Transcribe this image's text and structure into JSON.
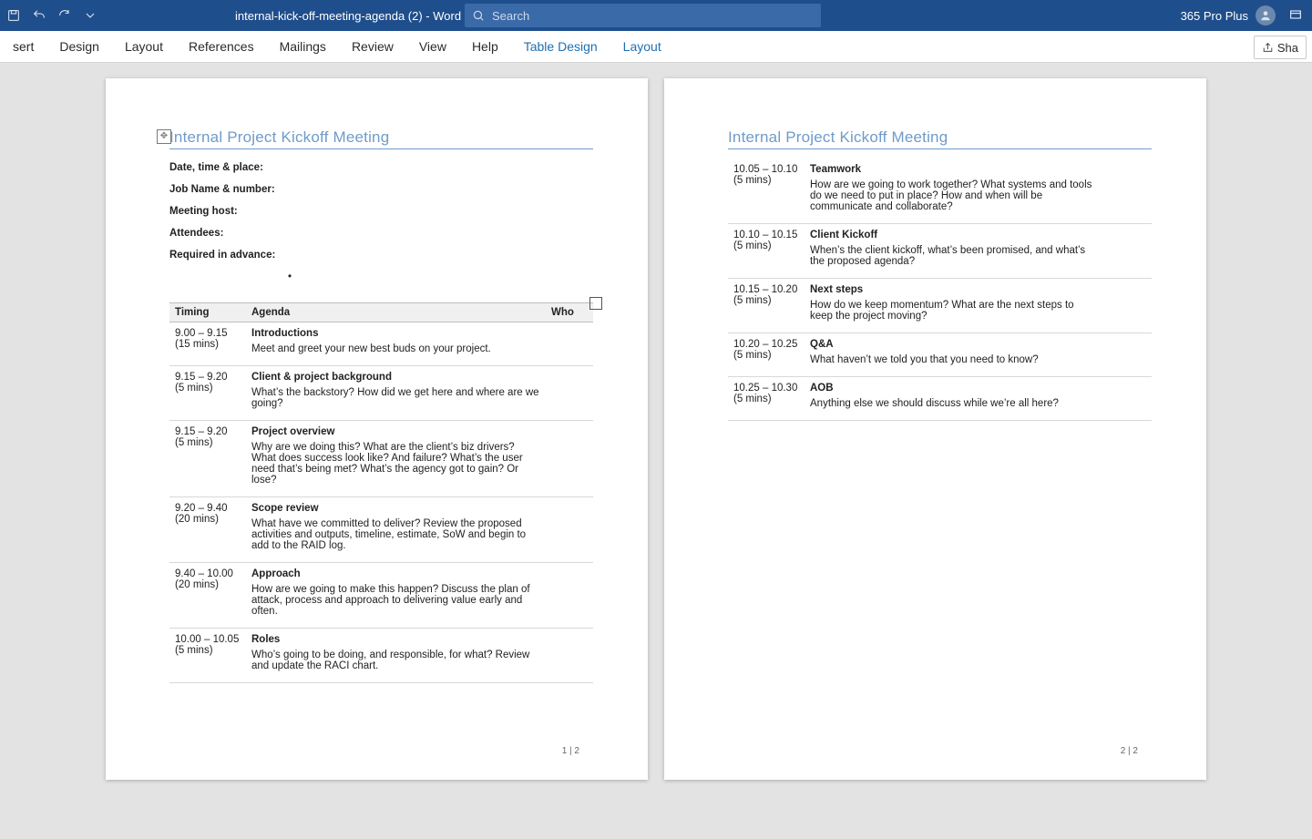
{
  "titlebar": {
    "doc_title": "internal-kick-off-meeting-agenda (2)  -  Word",
    "search_placeholder": "Search",
    "user_label": "365 Pro Plus"
  },
  "ribbon": {
    "tabs": [
      "sert",
      "Design",
      "Layout",
      "References",
      "Mailings",
      "Review",
      "View",
      "Help",
      "Table Design",
      "Layout"
    ],
    "share_label": "Sha"
  },
  "doc": {
    "title": "Internal Project Kickoff Meeting",
    "fields": {
      "date": "Date, time & place:",
      "job": "Job Name & number:",
      "host": "Meeting host:",
      "attendees": "Attendees:",
      "required": "Required in advance:"
    },
    "cols": {
      "timing": "Timing",
      "agenda": "Agenda",
      "who": "Who"
    },
    "page1_footer": "1 | 2",
    "page2_footer": "2 | 2"
  },
  "rows_p1": [
    {
      "time": "9.00 – 9.15",
      "dur": "(15 mins)",
      "title": "Introductions",
      "desc": "Meet and greet your new best buds on your project."
    },
    {
      "time": "9.15 – 9.20",
      "dur": "(5 mins)",
      "title": "Client & project background",
      "desc": "What’s the backstory? How did we get here and where are we going?"
    },
    {
      "time": "9.15 – 9.20",
      "dur": "(5 mins)",
      "title": "Project overview",
      "desc": "Why are we doing this? What are the client’s biz drivers? What does success look like? And failure? What’s the user need that’s being met? What’s the agency got to gain? Or lose?"
    },
    {
      "time": "9.20 – 9.40",
      "dur": "(20 mins)",
      "title": "Scope review",
      "desc": "What have we committed to deliver? Review the proposed activities and outputs, timeline, estimate, SoW and begin to add to the RAID log."
    },
    {
      "time": "9.40 – 10.00",
      "dur": "(20 mins)",
      "title": "Approach",
      "desc": "How are we going to make this happen? Discuss the plan of attack, process and approach to delivering value early and often."
    },
    {
      "time": "10.00 – 10.05",
      "dur": "(5 mins)",
      "title": "Roles",
      "desc": "Who’s going to be doing, and responsible, for what? Review and update the RACI chart."
    }
  ],
  "rows_p2": [
    {
      "time": "10.05 – 10.10",
      "dur": "(5 mins)",
      "title": "Teamwork",
      "desc": "How are we going to work together? What systems and tools do we need to put in place? How and when will be communicate and collaborate?"
    },
    {
      "time": "10.10 – 10.15",
      "dur": "(5 mins)",
      "title": "Client Kickoff",
      "desc": "When’s the client kickoff, what’s been promised, and what’s the proposed agenda?"
    },
    {
      "time": "10.15 – 10.20",
      "dur": "(5 mins)",
      "title": "Next steps",
      "desc": "How do we keep momentum? What are the next steps to keep the project moving?"
    },
    {
      "time": "10.20 – 10.25",
      "dur": "(5 mins)",
      "title": "Q&A",
      "desc": "What haven’t we told you that you need to know?"
    },
    {
      "time": "10.25 – 10.30",
      "dur": "(5 mins)",
      "title": "AOB",
      "desc": "Anything else we should discuss while we’re all here?"
    }
  ]
}
